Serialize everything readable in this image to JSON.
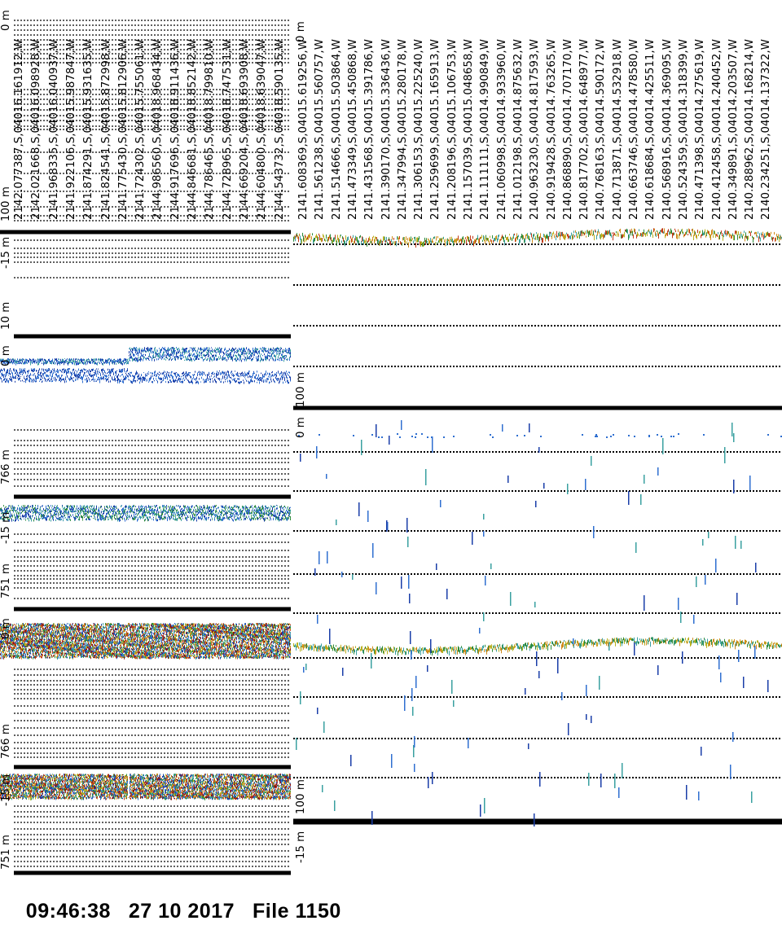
{
  "footer": {
    "time": "09:46:38",
    "date": "27 10 2017",
    "file": "File 1150"
  },
  "colors": {
    "ink": "#000000",
    "echo_palette": [
      "#1a3ea8",
      "#2f6fd0",
      "#3aa0a0",
      "#2e8b3a",
      "#b8b020",
      "#d08a1a",
      "#c23a1a",
      "#8a1010"
    ]
  },
  "left_panel": {
    "depth_labels": [
      "0 m",
      "100 m",
      "-15 m",
      "10 m",
      "0 m",
      "766 m",
      "-15 m",
      "751 m",
      "0 m",
      "766 m",
      "-15 m",
      "751 m"
    ],
    "nav_lines": [
      "2142.077387,S,04016.161912,W",
      "2142.021668,S,04016.098928,W",
      "2141.968335,S,04016.040937,W",
      "2141.922106,S,04015.987847,W",
      "2141.874291,S,04015.931635,W",
      "2141.824541,S,04015.872998,W",
      "2141.775430,S,04015.812906,W",
      "2141.724302,S,04015.755061,W",
      "2144.986560,S,04018.968434,W",
      "2144.917696,S,04018.911436,W",
      "2144.846681,S,04018.852142,W",
      "2144.786465,S,04018.799810,W",
      "2144.728965,S,04018.747531,W",
      "2144.669204,S,04018.693908,W",
      "2144.604800,S,04018.639047,W",
      "2144.543732,S,04018.590135,W"
    ]
  },
  "right_panel": {
    "depth_labels": [
      "0 m",
      "100 m",
      "0 m",
      "100 m",
      "-15 m"
    ],
    "nav_lines": [
      "2141.608369,S,04015.619256,W",
      "2141.561238,S,04015.560757,W",
      "2141.514666,S,04015.503864,W",
      "2141.473349,S,04015.450868,W",
      "2141.431568,S,04015.391786,W",
      "2141.390170,S,04015.336436,W",
      "2141.347994,S,04015.280178,W",
      "2141.306153,S,04015.225240,W",
      "2141.259699,S,04015.165913,W",
      "2141.208196,S,04015.106753,W",
      "2141.157039,S,04015.048658,W",
      "2141.111111,S,04014.990849,W",
      "2141.060998,S,04014.933960,W",
      "2141.012198,S,04014.875632,W",
      "2140.963230,S,04014.817593,W",
      "2140.919428,S,04014.763265,W",
      "2140.868890,S,04014.707170,W",
      "2140.817702,S,04014.648977,W",
      "2140.768163,S,04014.590172,W",
      "2140.713871,S,04014.532918,W",
      "2140.663746,S,04014.478580,W",
      "2140.618684,S,04014.425511,W",
      "2140.568916,S,04014.369095,W",
      "2140.524359,S,04014.318399,W",
      "2140.471398,S,04014.275619,W",
      "2140.412458,S,04014.240452,W",
      "2140.349891,S,04014.203507,W",
      "2140.288962,S,04014.168214,W",
      "2140.234251,S,04014.137322,W"
    ]
  }
}
